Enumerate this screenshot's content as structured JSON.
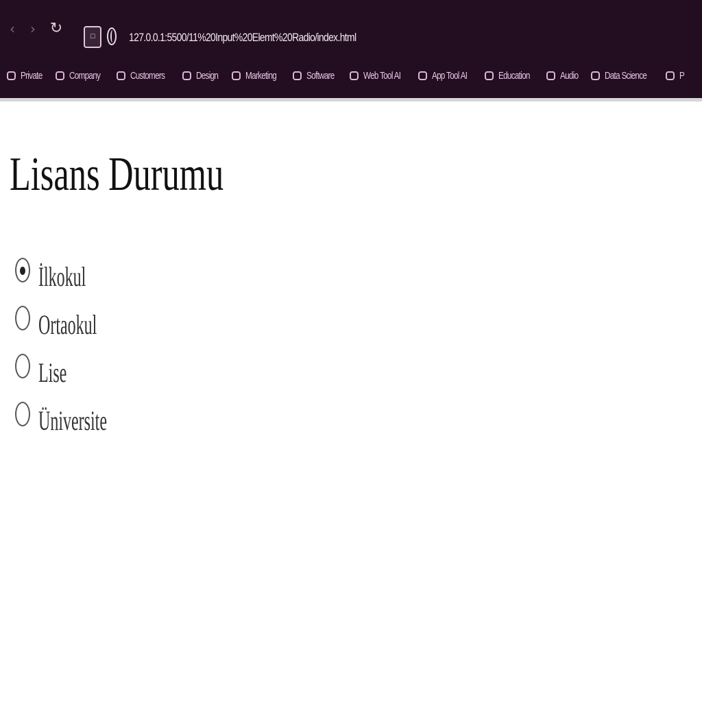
{
  "browser": {
    "nav": {
      "back": "‹",
      "forward": "›",
      "reload": "↻"
    },
    "site_badge": "☐",
    "url": "127.0.0.1:5500/11%20Input%20Elemt%20Radio/index.html",
    "bookmarks": [
      "Private",
      "Company",
      "Customers",
      "Design",
      "Marketing",
      "Software",
      "Web Tool AI",
      "App Tool AI",
      "Education",
      "Audio",
      "Data Science",
      "P"
    ],
    "colors": {
      "chrome_bg": "#230d21",
      "bookmark_text": "#e6c4e3"
    }
  },
  "page": {
    "title": "Lisans Durumu",
    "options": [
      {
        "label": "İlkokul",
        "checked": true
      },
      {
        "label": "Ortaokul",
        "checked": false
      },
      {
        "label": "Lise",
        "checked": false
      },
      {
        "label": "Üniversite",
        "checked": false
      }
    ]
  }
}
